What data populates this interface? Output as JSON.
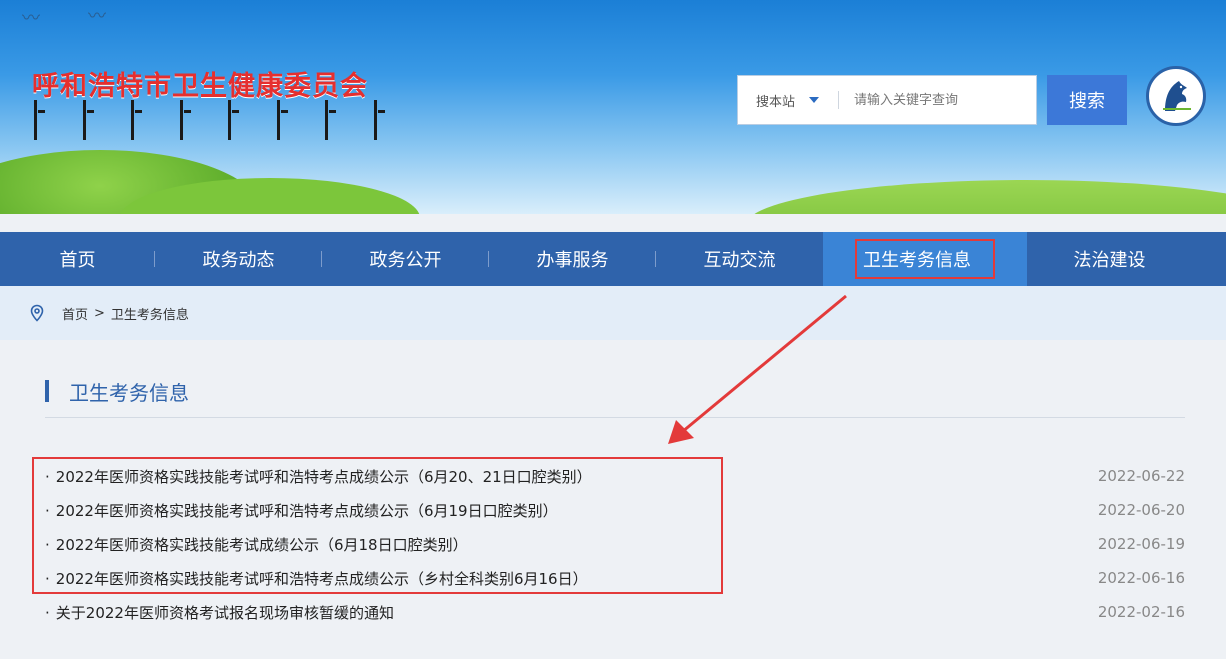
{
  "header": {
    "site_title": "呼和浩特市卫生健康委员会",
    "search": {
      "scope_label": "搜本站",
      "placeholder": "请输入关键字查询",
      "button_label": "搜索"
    }
  },
  "nav": {
    "items": [
      {
        "label": "首页"
      },
      {
        "label": "政务动态"
      },
      {
        "label": "政务公开"
      },
      {
        "label": "办事服务"
      },
      {
        "label": "互动交流"
      },
      {
        "label": "卫生考务信息",
        "active": true
      },
      {
        "label": "法治建设"
      }
    ]
  },
  "breadcrumb": {
    "home": "首页",
    "separator": ">",
    "current": "卫生考务信息"
  },
  "section": {
    "title": "卫生考务信息"
  },
  "articles": [
    {
      "title": "2022年医师资格实践技能考试呼和浩特考点成绩公示（6月20、21日口腔类别）",
      "date": "2022-06-22"
    },
    {
      "title": "2022年医师资格实践技能考试呼和浩特考点成绩公示（6月19日口腔类别）",
      "date": "2022-06-20"
    },
    {
      "title": "2022年医师资格实践技能考试成绩公示（6月18日口腔类别）",
      "date": "2022-06-19"
    },
    {
      "title": "2022年医师资格实践技能考试呼和浩特考点成绩公示（乡村全科类别6月16日）",
      "date": "2022-06-16"
    },
    {
      "title": "关于2022年医师资格考试报名现场审核暂缓的通知",
      "date": "2022-02-16"
    }
  ],
  "colors": {
    "nav_bg": "#2f63ab",
    "nav_active": "#3a84d6",
    "title_red": "#e52f2f",
    "highlight": "#e33a3a"
  }
}
